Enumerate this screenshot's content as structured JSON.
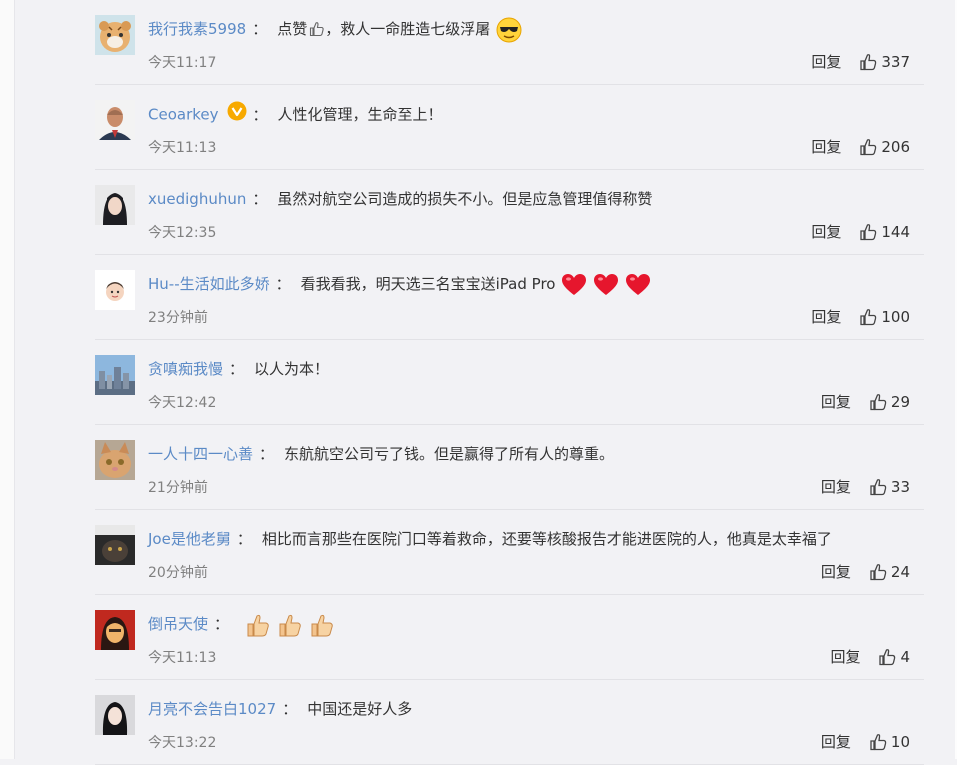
{
  "comments": [
    {
      "user": "我行我素5998",
      "text": "点赞",
      "text_after": "，救人一命胜造七级浮屠",
      "time": "今天11:17",
      "reply": "回复",
      "likes": "337",
      "avatar": "tiger",
      "emojis": [
        "sunglasses-icon"
      ]
    },
    {
      "user": "Ceoarkey",
      "text": "人性化管理，生命至上！",
      "time": "今天11:13",
      "reply": "回复",
      "likes": "206",
      "avatar": "man",
      "verified": true
    },
    {
      "user": "xuedighuhun",
      "text": "虽然对航空公司造成的损失不小。但是应急管理值得称赞",
      "time": "今天12:35",
      "reply": "回复",
      "likes": "144",
      "avatar": "girl"
    },
    {
      "user": "Hu--生活如此多娇",
      "text": "看我看我，明天选三名宝宝送iPad Pro",
      "time": "23分钟前",
      "reply": "回复",
      "likes": "100",
      "avatar": "cartoon",
      "emojis": [
        "heart-icon",
        "heart-icon",
        "heart-icon"
      ]
    },
    {
      "user": "贪嗔痴我慢",
      "text": "以人为本！",
      "time": "今天12:42",
      "reply": "回复",
      "likes": "29",
      "avatar": "city"
    },
    {
      "user": "一人十四一心善",
      "text": "东航航空公司亏了钱。但是赢得了所有人的尊重。",
      "time": "21分钟前",
      "reply": "回复",
      "likes": "33",
      "avatar": "cat"
    },
    {
      "user": "Joe是他老舅",
      "text": "相比而言那些在医院门口等着救命，还要等核酸报告才能进医院的人，他真是太幸福了",
      "time": "20分钟前",
      "reply": "回复",
      "likes": "24",
      "avatar": "dark"
    },
    {
      "user": "倒吊天使",
      "text": "",
      "time": "今天11:13",
      "reply": "回复",
      "likes": "4",
      "avatar": "red",
      "emojis": [
        "thumbs-up-icon",
        "thumbs-up-icon",
        "thumbs-up-icon"
      ]
    },
    {
      "user": "月亮不会告白1027",
      "text": "中国还是好人多",
      "time": "今天13:22",
      "reply": "回复",
      "likes": "10",
      "avatar": "girl2"
    }
  ],
  "colors": {
    "username": "#5b8ac6",
    "time": "#808080",
    "text": "#333333",
    "background": "#f2f2f5",
    "verified": "#f7a900"
  }
}
